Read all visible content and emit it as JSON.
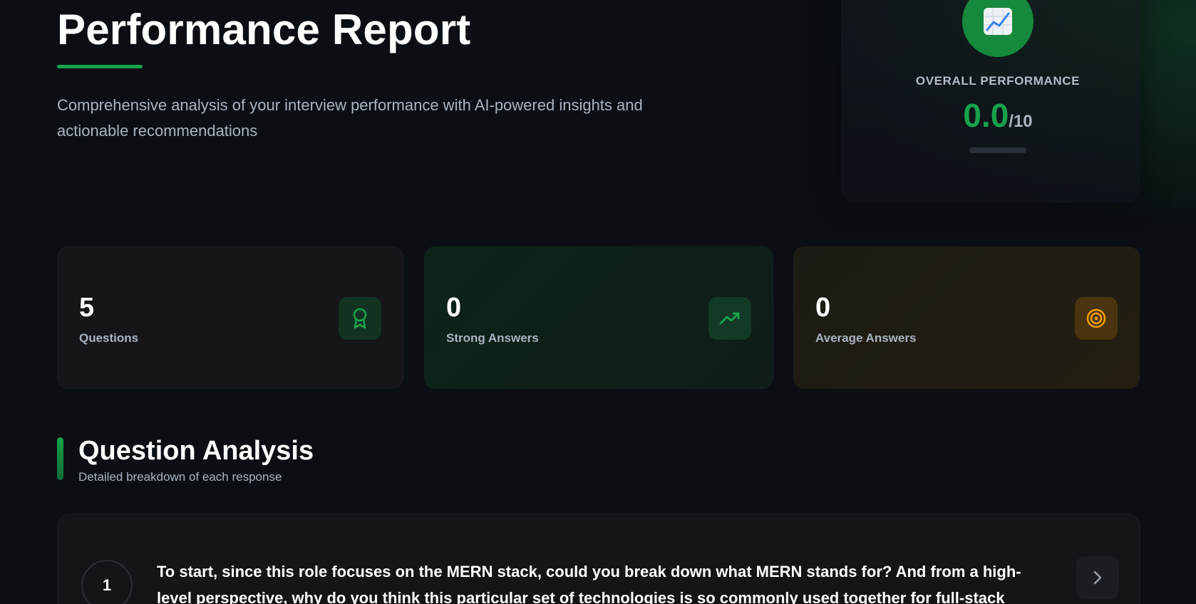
{
  "header": {
    "title": "Performance Report",
    "subtitle": "Comprehensive analysis of your interview performance with AI-powered insights and actionable recommendations"
  },
  "overall": {
    "label": "OVERALL PERFORMANCE",
    "score": "0.0",
    "max": "/10",
    "progress_fraction": 0,
    "icon": "chart-increasing-icon"
  },
  "stats": [
    {
      "value": "5",
      "label": "Questions",
      "icon": "award-icon",
      "accent": "#16a34a"
    },
    {
      "value": "0",
      "label": "Strong Answers",
      "icon": "trending-up-icon",
      "accent": "#16a34a"
    },
    {
      "value": "0",
      "label": "Average Answers",
      "icon": "target-icon",
      "accent": "#f59e0b"
    }
  ],
  "section": {
    "title": "Question Analysis",
    "subtitle": "Detailed breakdown of each response"
  },
  "questions": [
    {
      "number": "1",
      "text": "To start, since this role focuses on the MERN stack, could you break down what MERN stands for? And from a high-level perspective, why do you think this particular set of technologies is so commonly used together for full-stack"
    }
  ],
  "colors": {
    "background": "#0b0f14",
    "accent_green": "#16a34a",
    "accent_amber": "#f59e0b",
    "muted_text": "#aab4c0"
  }
}
